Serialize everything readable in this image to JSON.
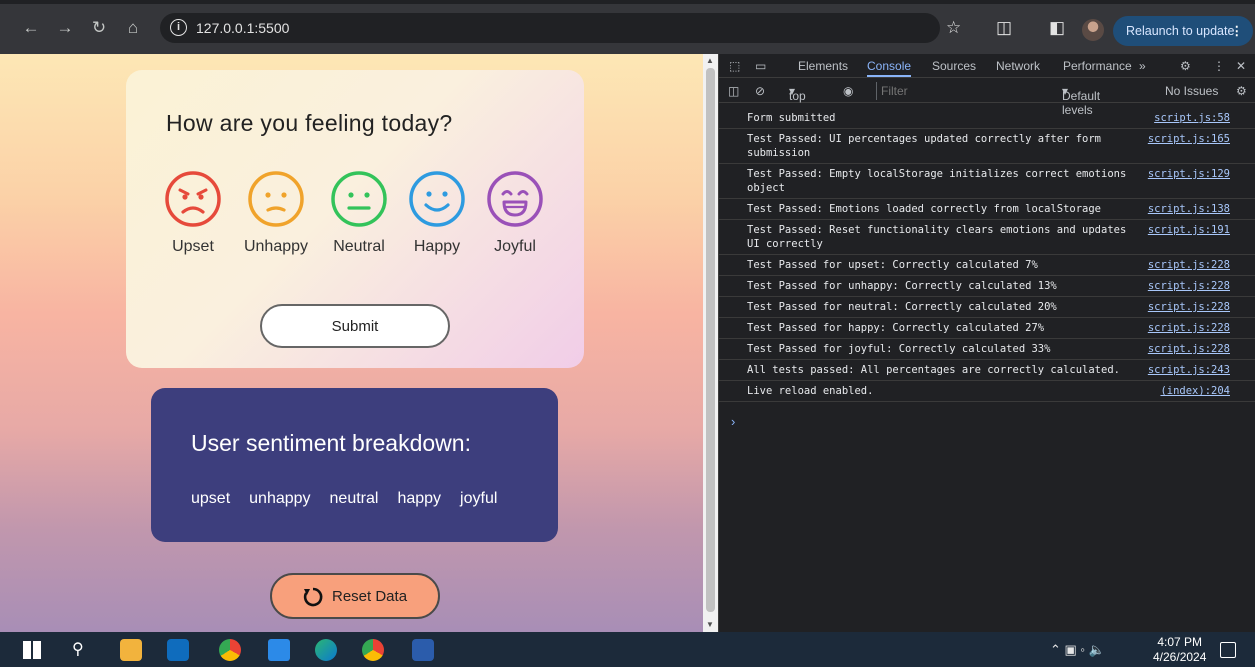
{
  "browser": {
    "url": "127.0.0.1:5500",
    "relaunch_label": "Relaunch to update"
  },
  "page": {
    "card_title": "How are you feeling today?",
    "emotions": [
      {
        "label": "Upset",
        "color": "#e64a3b"
      },
      {
        "label": "Unhappy",
        "color": "#f0a32b"
      },
      {
        "label": "Neutral",
        "color": "#33c35a"
      },
      {
        "label": "Happy",
        "color": "#2e9be0"
      },
      {
        "label": "Joyful",
        "color": "#9a51b8"
      }
    ],
    "submit_label": "Submit",
    "breakdown_title": "User sentiment breakdown:",
    "breakdown_items": [
      "upset",
      "unhappy",
      "neutral",
      "happy",
      "joyful"
    ],
    "reset_label": "Reset Data"
  },
  "devtools": {
    "tabs": [
      "Elements",
      "Console",
      "Sources",
      "Network",
      "Performance"
    ],
    "active_tab": "Console",
    "context": "top",
    "filter_placeholder": "Filter",
    "levels": "Default levels",
    "issues": "No Issues",
    "logs": [
      {
        "msg": "Form submitted",
        "src": "script.js:58"
      },
      {
        "msg": "Test Passed: UI percentages updated correctly after form submission",
        "src": "script.js:165"
      },
      {
        "msg": "Test Passed: Empty localStorage initializes correct emotions object",
        "src": "script.js:129"
      },
      {
        "msg": "Test Passed: Emotions loaded correctly from localStorage",
        "src": "script.js:138"
      },
      {
        "msg": "Test Passed: Reset functionality clears emotions and updates UI correctly",
        "src": "script.js:191"
      },
      {
        "msg": "Test Passed for upset: Correctly calculated 7%",
        "src": "script.js:228"
      },
      {
        "msg": "Test Passed for unhappy: Correctly calculated 13%",
        "src": "script.js:228"
      },
      {
        "msg": "Test Passed for neutral: Correctly calculated 20%",
        "src": "script.js:228"
      },
      {
        "msg": "Test Passed for happy: Correctly calculated 27%",
        "src": "script.js:228"
      },
      {
        "msg": "Test Passed for joyful: Correctly calculated 33%",
        "src": "script.js:228"
      },
      {
        "msg": "All tests passed: All percentages are correctly calculated.",
        "src": "script.js:243"
      },
      {
        "msg": "Live reload enabled.",
        "src": "(index):204"
      }
    ]
  },
  "taskbar": {
    "time": "4:07 PM",
    "date": "4/26/2024"
  }
}
